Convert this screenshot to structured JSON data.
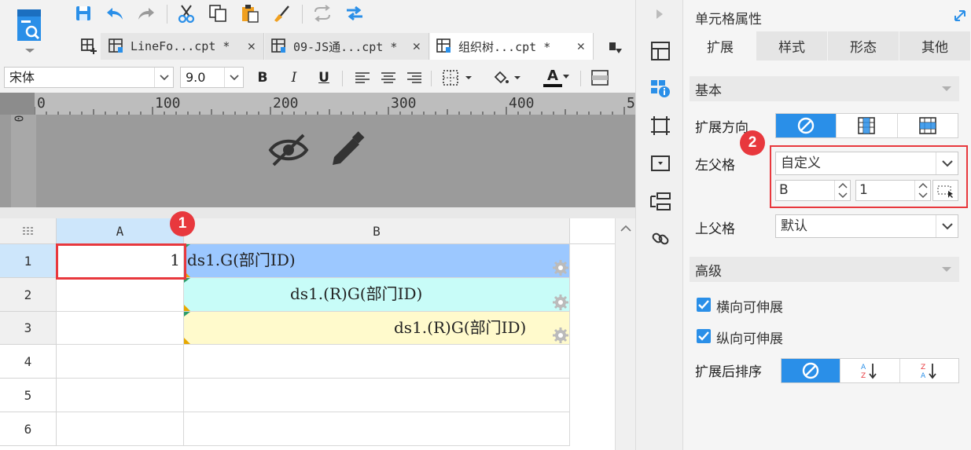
{
  "tabs": [
    {
      "name": "LineFo...cpt *",
      "close": "✕",
      "active": false
    },
    {
      "name": "09-JS通...cpt *",
      "close": "✕",
      "active": false
    },
    {
      "name": "组织树...cpt *",
      "close": "✕",
      "active": true
    }
  ],
  "format": {
    "font_name": "宋体",
    "font_size": "9.0",
    "bold": "B",
    "italic": "I",
    "underline": "U",
    "font_color_letter": "A"
  },
  "ruler": {
    "marks": [
      "0",
      "100",
      "200",
      "300",
      "400",
      "5"
    ],
    "vertical_mark": "0"
  },
  "sheet": {
    "columns": [
      "A",
      "B"
    ],
    "rows": [
      "1",
      "2",
      "3",
      "4",
      "5",
      "6"
    ],
    "cells": {
      "A1": "1",
      "B1": "ds1.G(部门ID)",
      "B2": "ds1.(R)G(部门ID)",
      "B3": "ds1.(R)G(部门ID)"
    }
  },
  "panel": {
    "title": "单元格属性",
    "tabs": [
      "扩展",
      "样式",
      "形态",
      "其他"
    ],
    "basic_section": "基本",
    "expand_direction_label": "扩展方向",
    "left_parent_label": "左父格",
    "left_parent_value": "自定义",
    "left_parent_col": "B",
    "left_parent_row": "1",
    "upper_parent_label": "上父格",
    "upper_parent_value": "默认",
    "advanced_section": "高级",
    "horizontal_extendable": "横向可伸展",
    "vertical_extendable": "纵向可伸展",
    "sort_after_expand_label": "扩展后排序"
  },
  "badges": [
    "1",
    "2"
  ],
  "colors": {
    "accent": "#2a8fe8",
    "highlight_red": "#e8383d",
    "b1_fill": "#9cc8ff",
    "b2_fill": "#c8fcf8",
    "b3_fill": "#fffacc"
  }
}
